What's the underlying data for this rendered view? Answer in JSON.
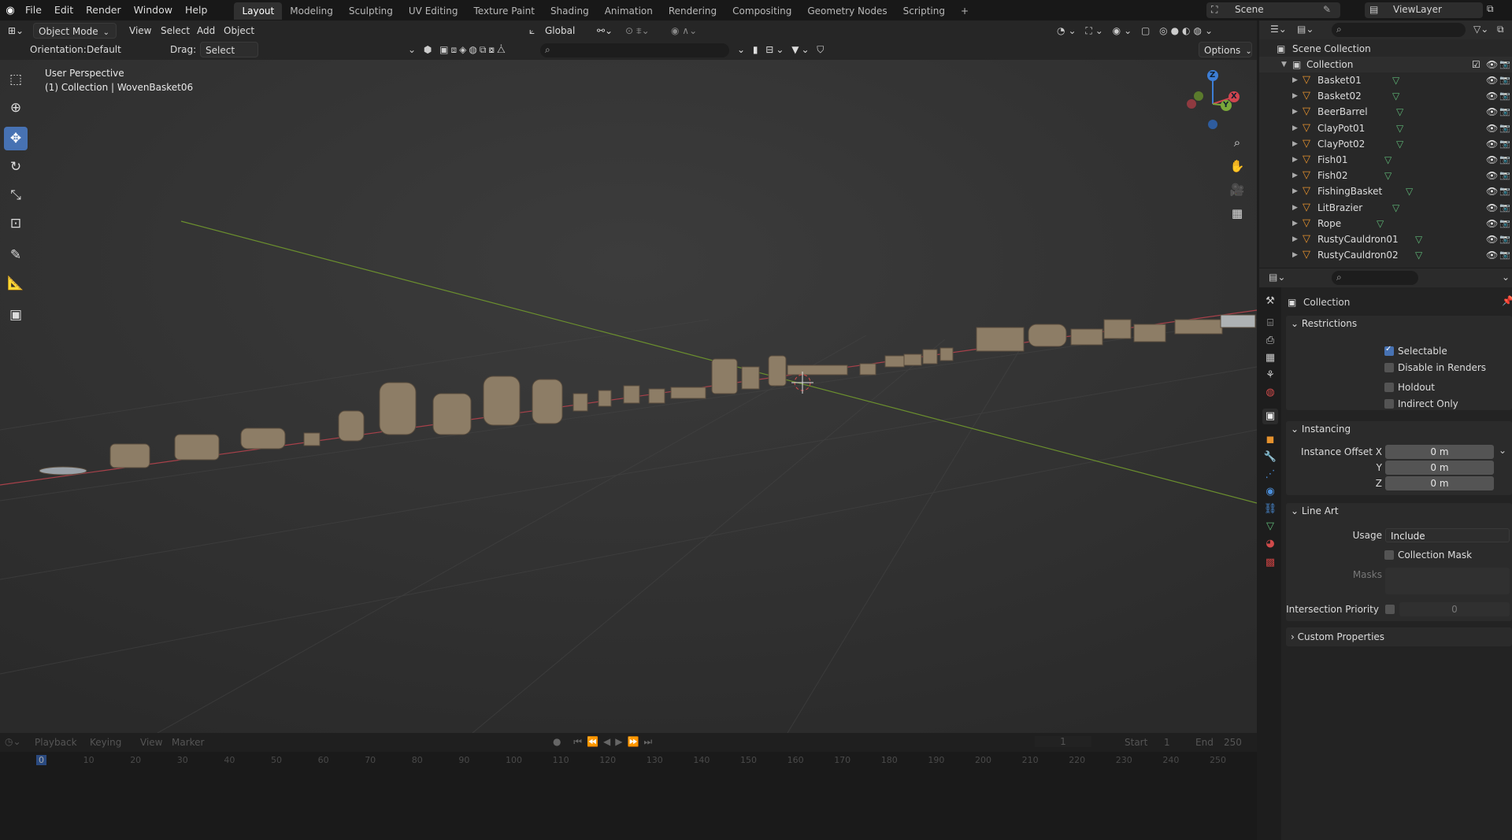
{
  "topbar": {
    "menus": [
      "File",
      "Edit",
      "Render",
      "Window",
      "Help"
    ],
    "workspaces": [
      "Layout",
      "Modeling",
      "Sculpting",
      "UV Editing",
      "Texture Paint",
      "Shading",
      "Animation",
      "Rendering",
      "Compositing",
      "Geometry Nodes",
      "Scripting"
    ],
    "active_workspace": "Layout",
    "add_tab": "+",
    "scene": "Scene",
    "view_layer": "ViewLayer"
  },
  "viewport_header": {
    "mode": "Object Mode",
    "menus": [
      "View",
      "Select",
      "Add",
      "Object"
    ],
    "transform_orientation": "Global",
    "orientation_label": "Orientation:",
    "orientation_value": "Default",
    "drag_label": "Drag:",
    "drag_value": "Select Box",
    "options": "Options"
  },
  "viewport": {
    "perspective": "User Perspective",
    "context": "(1) Collection | WovenBasket06",
    "gizmo_labels": [
      "Z",
      "Y",
      "X"
    ],
    "colors": {
      "x_axis": "#d0454f",
      "y_axis": "#7aa83a",
      "z_axis": "#3d7ed6",
      "bg": "#393939"
    }
  },
  "timeline": {
    "menus": [
      "Playback",
      "Keying",
      "View",
      "Marker"
    ],
    "current_frame": "1",
    "start_label": "Start",
    "start": "1",
    "end_label": "End",
    "end": "250",
    "ticks": [
      "0",
      "10",
      "20",
      "30",
      "40",
      "50",
      "60",
      "70",
      "80",
      "90",
      "100",
      "110",
      "120",
      "130",
      "140",
      "150",
      "160",
      "170",
      "180",
      "190",
      "200",
      "210",
      "220",
      "230",
      "240",
      "250"
    ]
  },
  "outliner": {
    "root": "Scene Collection",
    "collection": "Collection",
    "items": [
      "Basket01",
      "Basket02",
      "BeerBarrel",
      "ClayPot01",
      "ClayPot02",
      "Fish01",
      "Fish02",
      "FishingBasket",
      "LitBrazier",
      "Rope",
      "RustyCauldron01",
      "RustyCauldron02"
    ]
  },
  "properties": {
    "title": "Collection",
    "restrictions": {
      "header": "Restrictions",
      "selectable": "Selectable",
      "selectable_checked": true,
      "disable_in_renders": "Disable in Renders",
      "holdout": "Holdout",
      "indirect_only": "Indirect Only"
    },
    "instancing": {
      "header": "Instancing",
      "offset_x_label": "Instance Offset X",
      "y_label": "Y",
      "z_label": "Z",
      "x": "0 m",
      "y": "0 m",
      "z": "0 m"
    },
    "line_art": {
      "header": "Line Art",
      "usage_label": "Usage",
      "usage": "Include",
      "collection_mask": "Collection Mask",
      "masks_label": "Masks",
      "intersection_priority_label": "Intersection Priority",
      "intersection_priority": "0"
    },
    "custom_properties": "Custom Properties"
  }
}
